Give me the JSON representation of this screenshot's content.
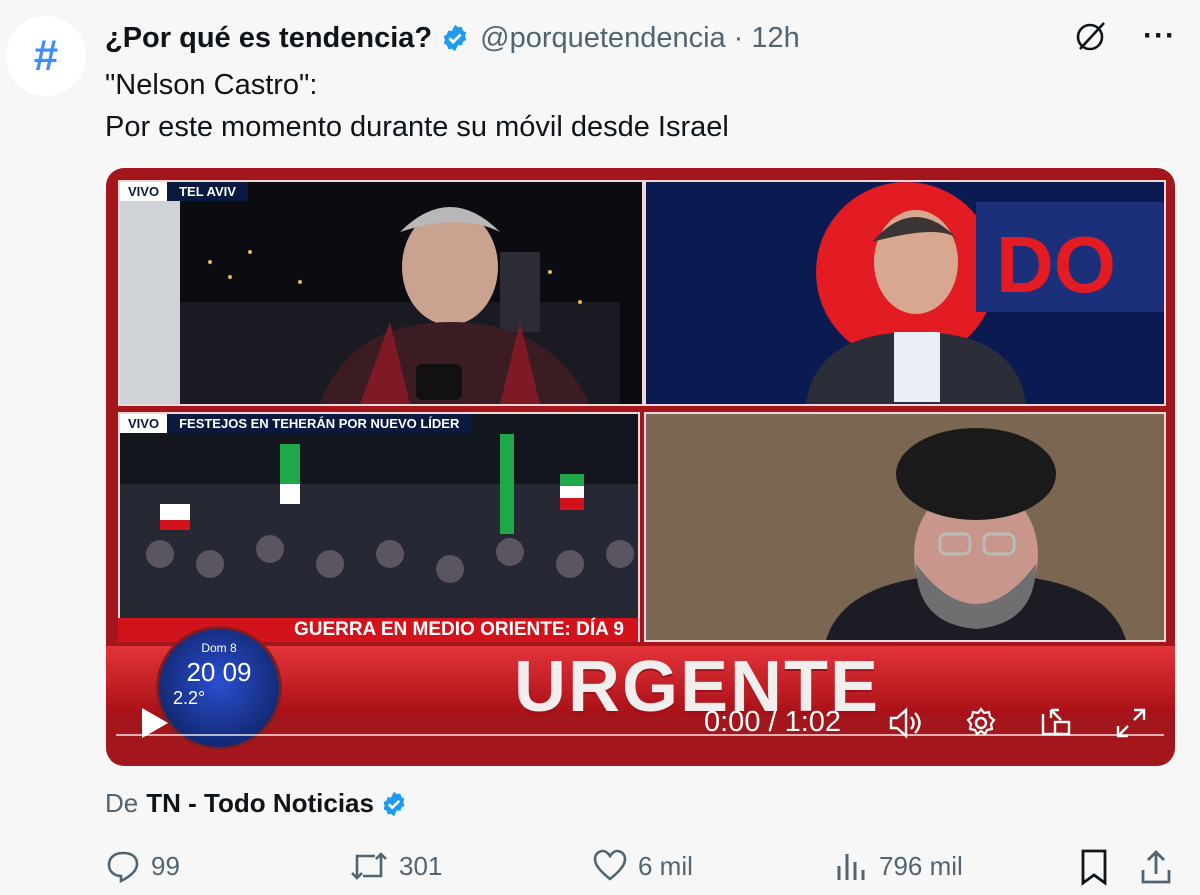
{
  "account": {
    "avatar_symbol": "#",
    "name": "¿Por qué es tendencia?",
    "handle": "@porquetendencia",
    "separator": "·",
    "time": "12h",
    "more": "···"
  },
  "tweet": {
    "line1": "\"Nelson Castro\":",
    "line2": "Por este momento durante su móvil desde Israel"
  },
  "video": {
    "tile1_tag_vivo": "VIVO",
    "tile1_tag_location": "TEL AVIV",
    "tile3_tag_vivo": "VIVO",
    "tile3_tag_caption": "FESTEJOS EN TEHERÁN POR NUEVO LÍDER",
    "banner": "GUERRA EN MEDIO ORIENTE: DÍA 9",
    "headline": "URGENTE",
    "clock_day": "Dom 8",
    "clock_time": "20 09",
    "clock_temp": "2.2°",
    "timecode": "0:00 / 1:02"
  },
  "provider": {
    "prefix": "De",
    "name": "TN - Todo Noticias"
  },
  "actions": {
    "replies": "99",
    "reposts": "301",
    "likes": "6 mil",
    "views": "796 mil"
  },
  "colors": {
    "verified": "#1d9bf0",
    "banner_red": "#d2131c",
    "icon_gray": "#536471"
  }
}
